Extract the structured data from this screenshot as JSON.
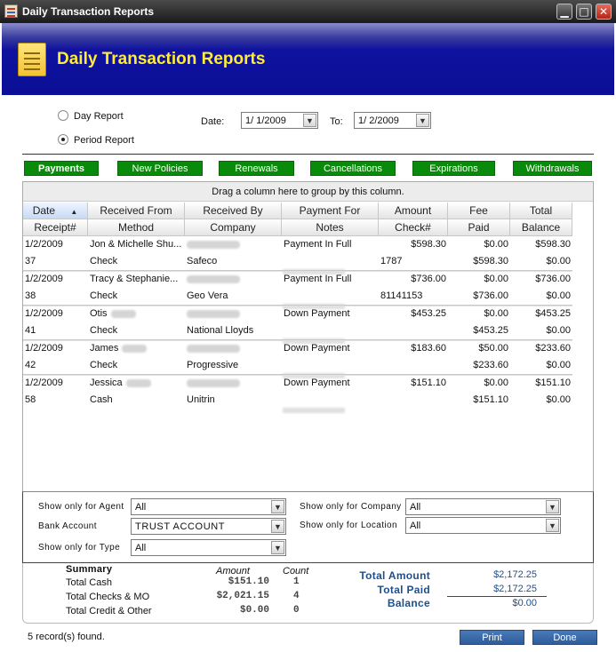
{
  "window": {
    "title": "Daily Transaction Reports",
    "min": "▁",
    "max": "□",
    "close": "✕"
  },
  "banner": {
    "title": "Daily Transaction Reports",
    "icon": "report-document-icon"
  },
  "report_mode": {
    "day_label": "Day Report",
    "period_label": "Period Report",
    "selected": "period"
  },
  "dates": {
    "date_label": "Date:",
    "date_value": "1/ 1/2009",
    "to_label": "To:",
    "to_value": "1/ 2/2009"
  },
  "tabs": [
    {
      "label": "Payments",
      "active": true
    },
    {
      "label": "New Policies",
      "active": false
    },
    {
      "label": "Renewals",
      "active": false
    },
    {
      "label": "Cancellations",
      "active": false
    },
    {
      "label": "Expirations",
      "active": false
    },
    {
      "label": "Withdrawals",
      "active": false
    }
  ],
  "grid": {
    "group_hint": "Drag a column here to group by this column.",
    "headers_top": [
      "Date",
      "Received From",
      "Received By",
      "Payment For",
      "Amount",
      "Fee",
      "Total"
    ],
    "headers_bottom": [
      "Receipt#",
      "Method",
      "Company",
      "Notes",
      "Check#",
      "Paid",
      "Balance"
    ],
    "sort_indicator": "▲",
    "rows": [
      {
        "date": "1/2/2009",
        "from": "Jon & Michelle Shu...",
        "payment_for": "Payment In Full",
        "amount": "$598.30",
        "fee": "$0.00",
        "total": "$598.30",
        "receipt": "37",
        "method": "Check",
        "company": "Safeco",
        "check": "1787",
        "paid": "$598.30",
        "balance": "$0.00"
      },
      {
        "date": "1/2/2009",
        "from": "Tracy & Stephanie...",
        "payment_for": "Payment In Full",
        "amount": "$736.00",
        "fee": "$0.00",
        "total": "$736.00",
        "receipt": "38",
        "method": "Check",
        "company": "Geo  Vera",
        "check": "81141153",
        "paid": "$736.00",
        "balance": "$0.00"
      },
      {
        "date": "1/2/2009",
        "from": "Otis",
        "payment_for": "Down Payment",
        "amount": "$453.25",
        "fee": "$0.00",
        "total": "$453.25",
        "receipt": "41",
        "method": "Check",
        "company": "National Lloyds",
        "check": "",
        "paid": "$453.25",
        "balance": "$0.00"
      },
      {
        "date": "1/2/2009",
        "from": "James",
        "payment_for": "Down Payment",
        "amount": "$183.60",
        "fee": "$50.00",
        "total": "$233.60",
        "receipt": "42",
        "method": "Check",
        "company": "Progressive",
        "check": "",
        "paid": "$233.60",
        "balance": "$0.00"
      },
      {
        "date": "1/2/2009",
        "from": "Jessica",
        "payment_for": "Down Payment",
        "amount": "$151.10",
        "fee": "$0.00",
        "total": "$151.10",
        "receipt": "58",
        "method": "Cash",
        "company": "Unitrin",
        "check": "",
        "paid": "$151.10",
        "balance": "$0.00"
      }
    ]
  },
  "filters": {
    "agent_label": "Show only for Agent",
    "agent_value": "All",
    "bank_label": "Bank Account",
    "bank_value": "TRUST ACCOUNT",
    "type_label": "Show only for Type",
    "type_value": "All",
    "company_label": "Show only for Company",
    "company_value": "All",
    "location_label": "Show only for Location",
    "location_value": "All"
  },
  "summary": {
    "title": "Summary",
    "amount_header": "Amount",
    "count_header": "Count",
    "rows": [
      {
        "label": "Total Cash",
        "amount": "$151.10",
        "count": "1"
      },
      {
        "label": "Total Checks & MO",
        "amount": "$2,021.15",
        "count": "4"
      },
      {
        "label": "Total Credit & Other",
        "amount": "$0.00",
        "count": "0"
      }
    ],
    "total_amount_label": "Total Amount",
    "total_amount": "$2,172.25",
    "total_paid_label": "Total Paid",
    "total_paid": "$2,172.25",
    "balance_label": "Balance",
    "balance": "$0.00"
  },
  "status": {
    "records": "5 record(s) found."
  },
  "buttons": {
    "print": "Print",
    "done": "Done"
  }
}
